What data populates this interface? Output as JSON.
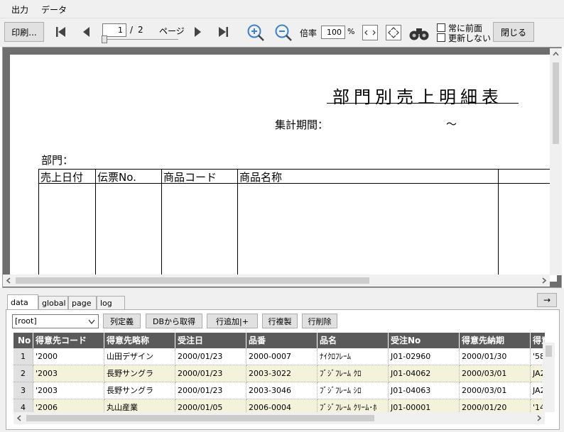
{
  "menu": {
    "output": "出力",
    "data": "データ"
  },
  "toolbar": {
    "print_label": "印刷...",
    "page_current": "1",
    "page_sep": "/",
    "page_total": "2",
    "page_unit": "ページ",
    "zoom_label": "倍率",
    "zoom_value": "100",
    "zoom_unit": "%",
    "always_front_label": "常に前面",
    "no_update_label": "更新しない",
    "close_label": "閉じる"
  },
  "report": {
    "title": "部門別売上明細表",
    "period_label": "集計期間：",
    "period_sep": "～",
    "dept_label": "部門：",
    "columns": [
      "売上日付",
      "伝票No.",
      "商品コード",
      "商品名称"
    ]
  },
  "tabs": [
    "data",
    "global",
    "page",
    "log"
  ],
  "arrow_button": "→",
  "data_panel": {
    "select_value": "[root]",
    "buttons": [
      "列定義",
      "DBから取得",
      "行追加|+",
      "行複製",
      "行削除"
    ]
  },
  "table": {
    "headers": [
      "No",
      "得意先コード",
      "得意先略称",
      "受注日",
      "品番",
      "品名",
      "受注No",
      "得意先納期",
      "得意"
    ],
    "rows": [
      [
        "1",
        "'2000",
        "山田デザイン",
        "2000/01/23",
        "2000-0007",
        "ﾅｲｸﾛﾌﾚｰﾑ",
        "J01-02960",
        "2000/01/30",
        "'58"
      ],
      [
        "2",
        "'2003",
        "長野サングラ",
        "2000/01/23",
        "2003-3022",
        "ﾌﾞｼﾞﾌﾚｰﾑ ｸﾛ",
        "J01-04062",
        "2000/03/01",
        "JA2"
      ],
      [
        "3",
        "'2003",
        "長野サングラ",
        "2000/01/23",
        "2003-3046",
        "ﾌﾞｼﾞﾌﾚｰﾑ ｼﾛ",
        "J01-04063",
        "2000/03/01",
        "JA2"
      ],
      [
        "4",
        "'2006",
        "丸山産業",
        "2000/01/05",
        "2006-0004",
        "ﾌﾞｼﾞﾌﾚｰﾑ ｸﾘｰﾑ･ﾎ",
        "J01-00001",
        "2000/01/20",
        "'14"
      ]
    ]
  }
}
